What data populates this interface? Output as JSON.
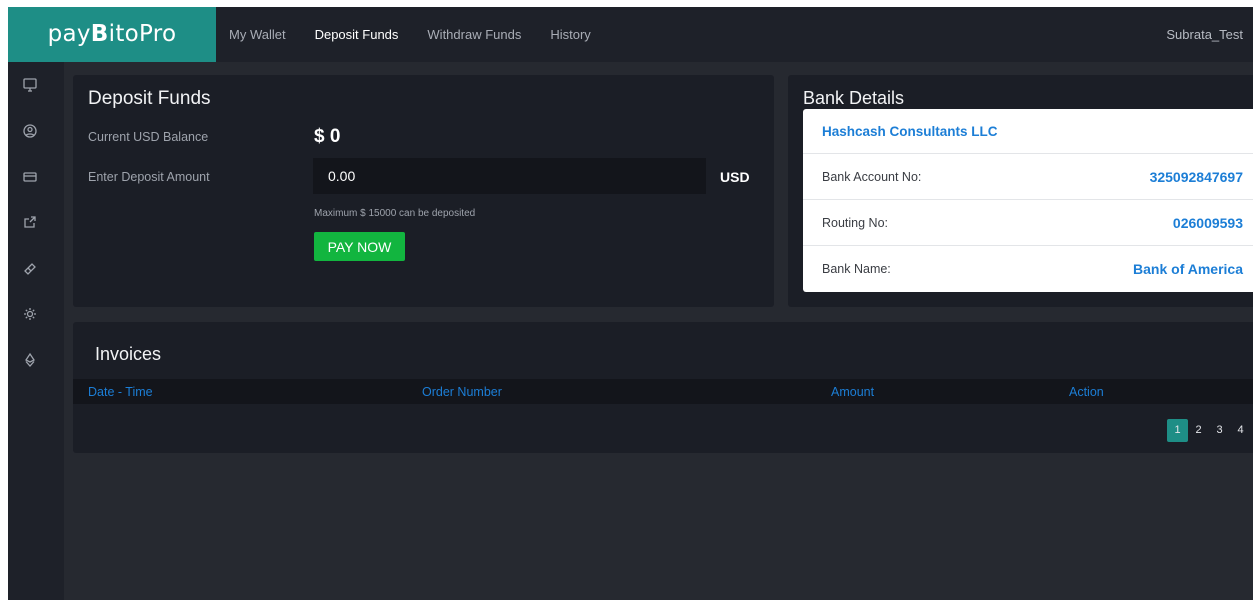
{
  "header": {
    "logo": {
      "prefix": "pay",
      "bold": "B",
      "suffix": "itoPro"
    },
    "nav": [
      {
        "label": "My Wallet",
        "active": false
      },
      {
        "label": "Deposit Funds",
        "active": true
      },
      {
        "label": "Withdraw Funds",
        "active": false
      },
      {
        "label": "History",
        "active": false
      }
    ],
    "user": "Subrata_Test"
  },
  "sidebar": {
    "icons": [
      "monitor-icon",
      "user-circle-icon",
      "wallet-card-icon",
      "share-export-icon",
      "ticket-icon",
      "settings-icon",
      "ethereum-icon"
    ]
  },
  "deposit": {
    "title": "Deposit Funds",
    "balance_label": "Current USD Balance",
    "balance_value": "$ 0",
    "amount_label": "Enter Deposit Amount",
    "amount_value": "0.00",
    "currency": "USD",
    "hint": "Maximum $ 15000 can be deposited",
    "pay_label": "PAY NOW"
  },
  "bank": {
    "title": "Bank Details",
    "company": "Hashcash Consultants LLC",
    "rows": [
      {
        "label": "Bank Account No:",
        "value": "325092847697"
      },
      {
        "label": "Routing No:",
        "value": "026009593"
      },
      {
        "label": "Bank Name:",
        "value": "Bank of America"
      }
    ]
  },
  "invoices": {
    "title": "Invoices",
    "columns": [
      "Date - Time",
      "Order Number",
      "Amount",
      "Action"
    ],
    "pages": [
      "1",
      "2",
      "3",
      "4"
    ],
    "current_page": "1"
  },
  "colors": {
    "accent": "#1e8e86",
    "link": "#1c7ed6",
    "success": "#12b53f",
    "panel": "#1b1e26",
    "background": "#262930"
  }
}
